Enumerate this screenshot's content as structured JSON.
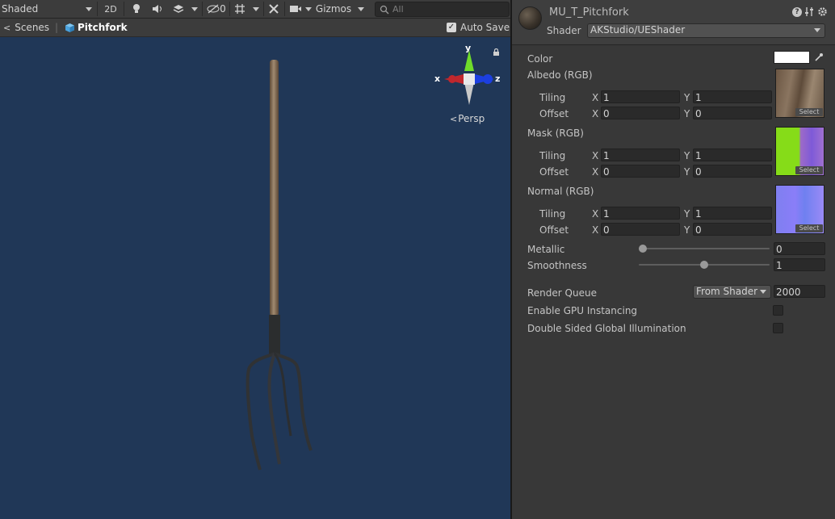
{
  "toolbar": {
    "draw_mode": "Shaded",
    "mode_2d": "2D",
    "hidden_count": "0",
    "gizmos_label": "Gizmos",
    "search_placeholder": "All"
  },
  "breadcrumb": {
    "scenes": "Scenes",
    "object": "Pitchfork",
    "auto_save_label": "Auto Save",
    "auto_save_checked": true
  },
  "gizmo": {
    "x": "x",
    "y": "y",
    "z": "z",
    "projection": "Persp"
  },
  "inspector": {
    "material_name": "MU_T_Pitchfork",
    "shader_label": "Shader",
    "shader_value": "AKStudio/UEShader",
    "color_label": "Color",
    "color_value": "#ffffff",
    "textures": [
      {
        "label": "Albedo (RGB)",
        "tiling_label": "Tiling",
        "offset_label": "Offset",
        "tiling_x": "1",
        "tiling_y": "1",
        "offset_x": "0",
        "offset_y": "0",
        "select": "Select"
      },
      {
        "label": "Mask (RGB)",
        "tiling_label": "Tiling",
        "offset_label": "Offset",
        "tiling_x": "1",
        "tiling_y": "1",
        "offset_x": "0",
        "offset_y": "0",
        "select": "Select"
      },
      {
        "label": "Normal (RGB)",
        "tiling_label": "Tiling",
        "offset_label": "Offset",
        "tiling_x": "1",
        "tiling_y": "1",
        "offset_x": "0",
        "offset_y": "0",
        "select": "Select"
      }
    ],
    "axis_x": "X",
    "axis_y": "Y",
    "metallic_label": "Metallic",
    "metallic_value": "0",
    "smoothness_label": "Smoothness",
    "smoothness_value": "1",
    "render_queue_label": "Render Queue",
    "render_queue_mode": "From Shader",
    "render_queue_value": "2000",
    "gpu_instancing_label": "Enable GPU Instancing",
    "gpu_instancing_checked": false,
    "double_sided_gi_label": "Double Sided Global Illumination",
    "double_sided_gi_checked": false
  },
  "colors": {
    "scene_bg": "#203757",
    "panel_bg": "#383838",
    "toolbar_bg": "#3c3c3c",
    "gizmo_x": "#c0272d",
    "gizmo_y": "#6fdc2a",
    "gizmo_z": "#1c3fe0",
    "breadcrumb_active": "#ffffff",
    "unity_icon_blue": "#4aa3df"
  },
  "icons": {
    "light": "light-bulb-icon",
    "audio": "speaker-icon",
    "effects": "effects-stack-icon",
    "hidden": "eye-slash-icon",
    "grid": "grid-snap-icon",
    "tools": "tools-icon",
    "camera": "camera-icon",
    "search": "search-icon",
    "lock": "lock-icon",
    "help": "help-icon",
    "presets": "sliders-icon",
    "settings": "gear-icon",
    "eyedropper": "eyedropper-icon"
  }
}
